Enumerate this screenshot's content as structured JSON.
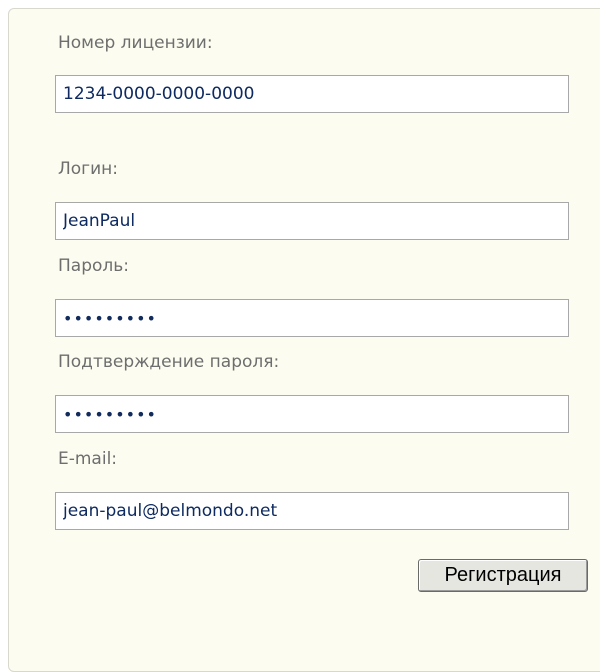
{
  "form": {
    "license": {
      "label": "Номер лицензии:",
      "value": "1234-0000-0000-0000"
    },
    "login": {
      "label": "Логин:",
      "value": "JeanPaul"
    },
    "password": {
      "label": "Пароль:",
      "value": "•••••••••"
    },
    "password_confirm": {
      "label": "Подтверждение пароля:",
      "value": "•••••••••"
    },
    "email": {
      "label": "E-mail:",
      "value": "jean-paul@belmondo.net"
    },
    "submit_label": "Регистрация"
  },
  "colors": {
    "panel_bg": "#fcfcf0",
    "label_text": "#6e6e6e",
    "field_text": "#0e2a60"
  }
}
